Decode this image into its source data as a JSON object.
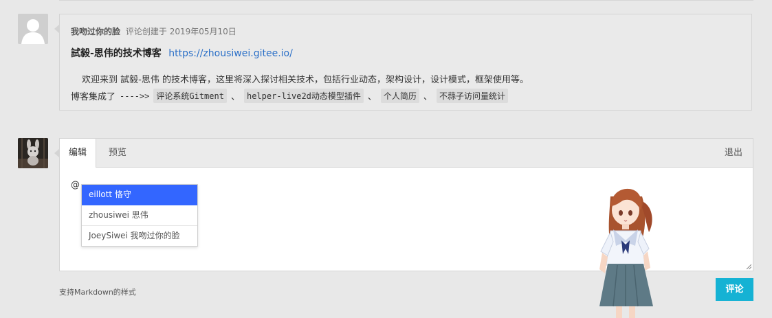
{
  "comment": {
    "author": "我吻过你的脸",
    "created_prefix": "评论创建于",
    "created_date": "2019年05月10日",
    "title": "試毅-思伟的技术博客",
    "link": "https://zhousiwei.gitee.io/",
    "paragraph": "欢迎来到 試毅-思伟 的技术博客，这里将深入探讨相关技术，包括行业动态，架构设计，设计模式，框架使用等。",
    "line2_prefix": "博客集成了",
    "line2_arrow": "---->>",
    "tags": [
      "评论系统Gitment",
      "helper-live2d动态模型插件",
      "个人简历",
      "不蒜子访问量统计"
    ],
    "separator": "、"
  },
  "editor": {
    "tabs": {
      "edit": "编辑",
      "preview": "预览"
    },
    "logout": "退出",
    "text": "@"
  },
  "mention": {
    "items": [
      {
        "label": "eillott 恪守",
        "active": true
      },
      {
        "label": "zhousiwei 思伟",
        "active": false
      },
      {
        "label": "JoeySiwei 我吻过你的脸",
        "active": false
      }
    ]
  },
  "footer": {
    "markdown_hint": "支持Markdown的样式",
    "submit_label": "评论"
  },
  "colors": {
    "accent": "#15b2d4",
    "link": "#2a6fc7",
    "mention_active": "#3366ff"
  }
}
